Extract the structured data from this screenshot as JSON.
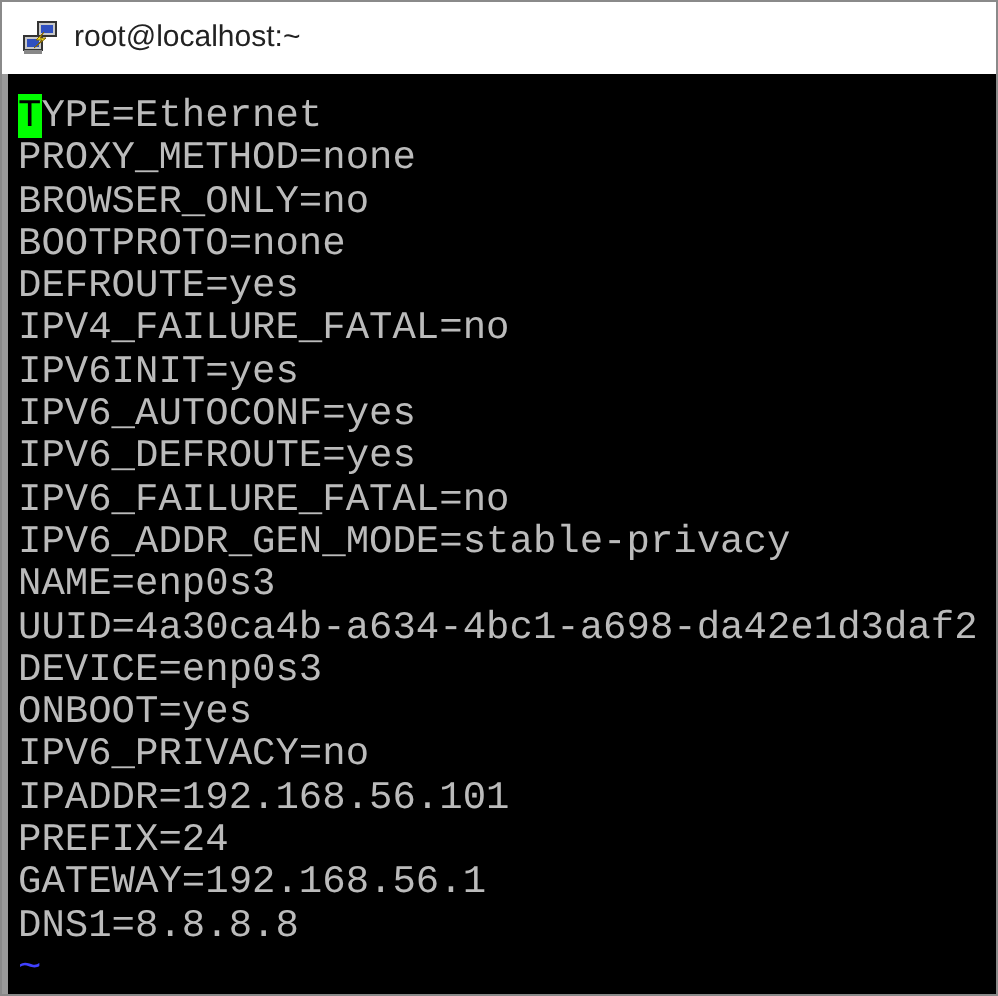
{
  "window": {
    "title": "root@localhost:~"
  },
  "terminal": {
    "lines": [
      {
        "text": "TYPE=Ethernet",
        "cursor": true
      },
      {
        "text": "PROXY_METHOD=none",
        "cursor": false
      },
      {
        "text": "BROWSER_ONLY=no",
        "cursor": false
      },
      {
        "text": "BOOTPROTO=none",
        "cursor": false
      },
      {
        "text": "DEFROUTE=yes",
        "cursor": false
      },
      {
        "text": "IPV4_FAILURE_FATAL=no",
        "cursor": false
      },
      {
        "text": "IPV6INIT=yes",
        "cursor": false
      },
      {
        "text": "IPV6_AUTOCONF=yes",
        "cursor": false
      },
      {
        "text": "IPV6_DEFROUTE=yes",
        "cursor": false
      },
      {
        "text": "IPV6_FAILURE_FATAL=no",
        "cursor": false
      },
      {
        "text": "IPV6_ADDR_GEN_MODE=stable-privacy",
        "cursor": false
      },
      {
        "text": "NAME=enp0s3",
        "cursor": false
      },
      {
        "text": "UUID=4a30ca4b-a634-4bc1-a698-da42e1d3daf2",
        "cursor": false
      },
      {
        "text": "DEVICE=enp0s3",
        "cursor": false
      },
      {
        "text": "ONBOOT=yes",
        "cursor": false
      },
      {
        "text": "IPV6_PRIVACY=no",
        "cursor": false
      },
      {
        "text": "IPADDR=192.168.56.101",
        "cursor": false
      },
      {
        "text": "PREFIX=24",
        "cursor": false
      },
      {
        "text": "GATEWAY=192.168.56.1",
        "cursor": false
      },
      {
        "text": "DNS1=8.8.8.8",
        "cursor": false
      }
    ],
    "empty_line_markers": [
      "~"
    ]
  }
}
